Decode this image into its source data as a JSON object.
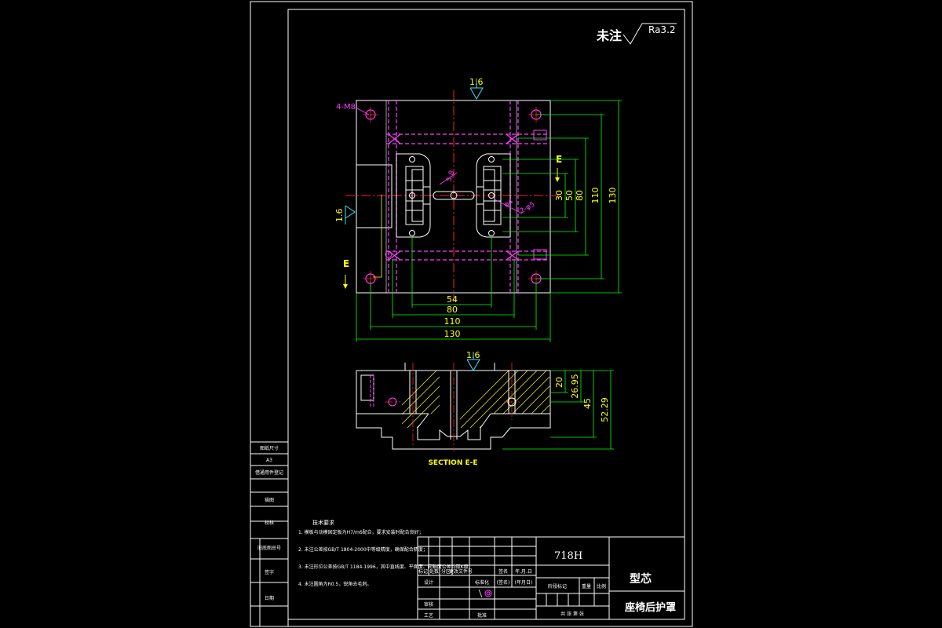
{
  "roughness_note": {
    "label": "未注",
    "value": "Ra3.2"
  },
  "surface_marks": {
    "top": "1.6",
    "left": "1.6",
    "section": "1.6"
  },
  "hole_note": "4-M8",
  "section_marker": "E",
  "section_title": "SECTION E-E",
  "plan_callouts": {
    "radius": "R4",
    "dia": "2-φ5",
    "small": "φ4",
    "diag": "5.8"
  },
  "dims_bottom": [
    "54",
    "80",
    "110",
    "130"
  ],
  "dims_right": [
    "30",
    "50",
    "80",
    "110",
    "130"
  ],
  "dims_section": [
    "20",
    "26.95",
    "45",
    "52.29"
  ],
  "left_strip": [
    "图纸尺寸",
    "A3",
    "借通用件登记",
    "",
    "描图",
    "",
    "校核",
    "旧底图总号",
    "签字",
    "日期"
  ],
  "tech_req": {
    "title": "技术要求",
    "items": [
      "1. 模板与动模固定板为H7/m6配合，要求安装时配合良好；",
      "2. 未注公差按GB/T 1804-2000中等级精度，确保配合精度；",
      "3. 未注形位公差按GB/T 1184-1996，其中直线度、平面度、同轴度公差均取K级；",
      "4. 未注圆角为R0.5，锐角去毛刺。"
    ]
  },
  "title_block": {
    "material": "718H",
    "part_name": "型芯",
    "product_name": "座椅后护罩",
    "cols": [
      "标记",
      "处数",
      "分区",
      "更改文件号",
      "签名",
      "年.月.日"
    ],
    "rows": [
      "设计",
      "审核",
      "工艺"
    ],
    "std_label": "标准化",
    "sign_label": "(签名)",
    "date_label": "(年月日)",
    "approve_label": "批准",
    "stage_labels": [
      "阶段标记",
      "重量",
      "比例"
    ],
    "sheet_label": "共 张 第 张"
  }
}
